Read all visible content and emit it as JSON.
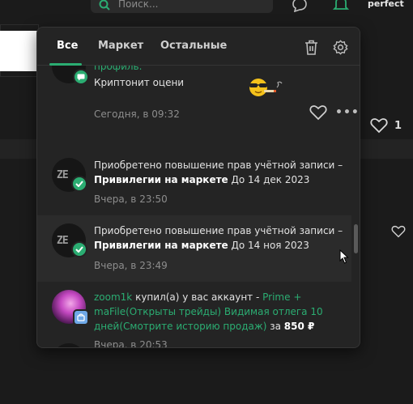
{
  "header": {
    "search_placeholder": "Поиск...",
    "user_name": "perfect"
  },
  "background": {
    "like_count": "1"
  },
  "popup": {
    "tabs": [
      {
        "label": "Все",
        "active": true
      },
      {
        "label": "Маркет",
        "active": false
      },
      {
        "label": "Остальные",
        "active": false
      }
    ],
    "notifications": [
      {
        "partial_top": "профиль.",
        "text": "Криптонит оцени",
        "emoji": "sunglasses-cigar-emoji",
        "time": "Сегодня, в 09:32"
      },
      {
        "text_plain": "Приобретено повышение прав учётной записи – ",
        "text_bold": "Привилегии на маркете",
        "text_after": " До 14 дек 2023",
        "time": "Вчера, в 23:50"
      },
      {
        "text_plain": "Приобретено повышение прав учётной записи – ",
        "text_bold": "Привилегии на маркете",
        "text_after": " До 14 ноя 2023",
        "time": "Вчера, в 23:49"
      },
      {
        "user": "zoom1k",
        "action": " купил(а) у вас аккаунт - ",
        "item": "Prime + maFile(Открыты трейды) Видимая отлега 10 дней(Смотрите историю продаж)",
        "for_word": " за ",
        "price": "850 ₽",
        "time": "Вчера, в 20:53"
      }
    ]
  },
  "colors": {
    "accent": "#2bad72",
    "background": "#1b1b1b",
    "popup": "#242424"
  }
}
